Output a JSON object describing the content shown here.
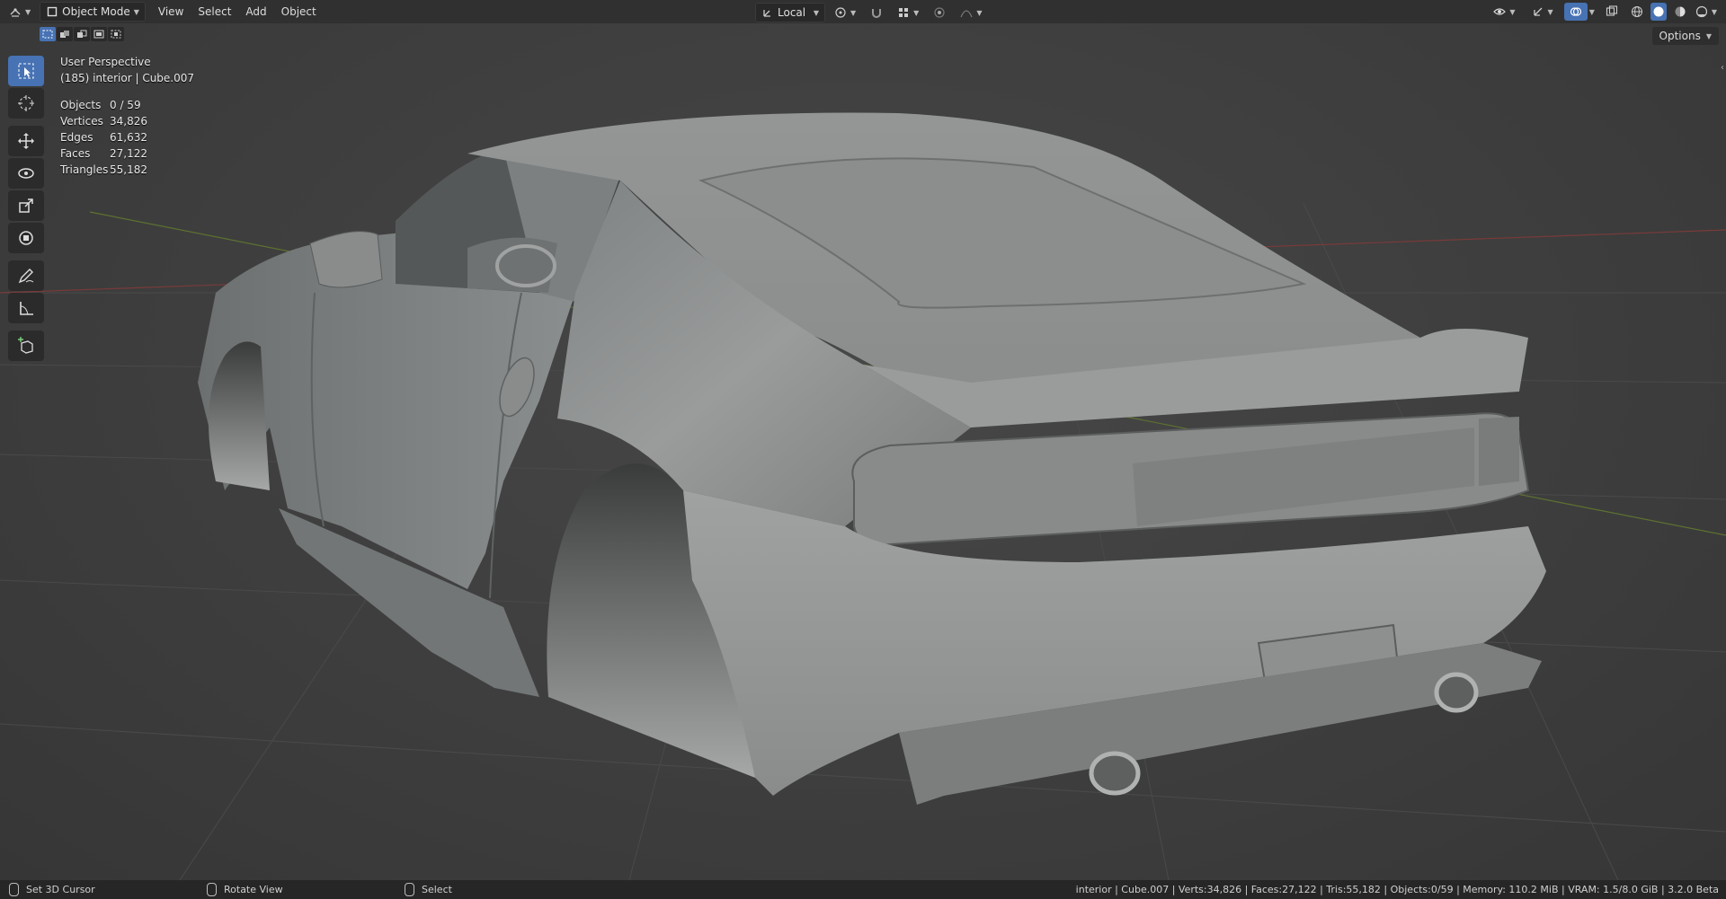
{
  "header": {
    "editor_type_icon": "3d-viewport-icon",
    "mode_label": "Object Mode",
    "menus": [
      "View",
      "Select",
      "Add",
      "Object"
    ],
    "transform_orientation": "Local",
    "options_label": "Options"
  },
  "overlay": {
    "view_name": "User Perspective",
    "object_info": "(185) interior | Cube.007",
    "stats": [
      {
        "label": "Objects",
        "value": "0 / 59"
      },
      {
        "label": "Vertices",
        "value": "34,826"
      },
      {
        "label": "Edges",
        "value": "61,632"
      },
      {
        "label": "Faces",
        "value": "27,122"
      },
      {
        "label": "Triangles",
        "value": "55,182"
      }
    ]
  },
  "toolbar": {
    "tools": [
      {
        "name": "select-box-tool",
        "icon": "select-box-icon",
        "active": true
      },
      {
        "name": "cursor-tool",
        "icon": "cursor-icon",
        "active": false
      },
      {
        "name": "move-tool",
        "icon": "move-icon",
        "active": false
      },
      {
        "name": "rotate-tool",
        "icon": "rotate-icon",
        "active": false
      },
      {
        "name": "scale-tool",
        "icon": "scale-icon",
        "active": false
      },
      {
        "name": "transform-tool",
        "icon": "transform-icon",
        "active": false
      },
      {
        "name": "annotate-tool",
        "icon": "annotate-icon",
        "active": false
      },
      {
        "name": "measure-tool",
        "icon": "measure-icon",
        "active": false
      },
      {
        "name": "add-cube-tool",
        "icon": "add-cube-icon",
        "active": false
      }
    ]
  },
  "statusbar": {
    "hints": [
      {
        "label": "Set 3D Cursor",
        "icon": "mouse-left-icon"
      },
      {
        "label": "Rotate View",
        "icon": "mouse-middle-icon"
      },
      {
        "label": "Select",
        "icon": "mouse-left-icon"
      }
    ],
    "info": "interior | Cube.007 | Verts:34,826 | Faces:27,122 | Tris:55,182 | Objects:0/59 | Memory: 110.2 MiB | VRAM: 1.5/8.0 GiB | 3.2.0 Beta"
  },
  "colors": {
    "accent": "#4772b3",
    "x_axis": "#8a3a3a",
    "y_axis": "#6e8a2a",
    "model": "#8e9090"
  }
}
